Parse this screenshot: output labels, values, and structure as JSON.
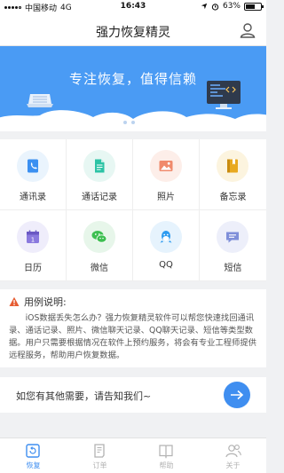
{
  "status_bar": {
    "carrier": "中国移动",
    "network": "4G",
    "time": "16:43",
    "battery_text": "63%",
    "battery_level": 0.63
  },
  "nav": {
    "title": "强力恢复精灵",
    "user_icon": "user-icon"
  },
  "banner": {
    "slogan": "专注恢复，值得信赖",
    "active_slide": 2,
    "slide_count": 3
  },
  "features": [
    {
      "label": "通讯录",
      "icon": "contacts-icon",
      "color": "#3b90f1",
      "bg": "#eaf4fd"
    },
    {
      "label": "通话记录",
      "icon": "call-log-icon",
      "color": "#2cc3a5",
      "bg": "#e7f7f3"
    },
    {
      "label": "照片",
      "icon": "photos-icon",
      "color": "#f08a6c",
      "bg": "#fdeee9"
    },
    {
      "label": "备忘录",
      "icon": "memo-icon",
      "color": "#e8a920",
      "bg": "#fcf4df"
    },
    {
      "label": "日历",
      "icon": "calendar-icon",
      "color": "#8a79de",
      "bg": "#efedfb"
    },
    {
      "label": "微信",
      "icon": "wechat-icon",
      "color": "#3dbf51",
      "bg": "#e7f6ea"
    },
    {
      "label": "QQ",
      "icon": "qq-icon",
      "color": "#2d9bf0",
      "bg": "#e6f3fd"
    },
    {
      "label": "短信",
      "icon": "sms-icon",
      "color": "#7f8fd9",
      "bg": "#edeffa"
    }
  ],
  "usage": {
    "title": "用例说明:",
    "body": "iOS数据丢失怎么办？强力恢复精灵软件可以帮您快速找回通讯录、通话记录、照片、微信聊天记录、QQ聊天记录、短信等类型数据。用户只需要根据情况在软件上预约服务，将会有专业工程师提供远程服务，帮助用户恢复数据。"
  },
  "contact": {
    "text": "如您有其他需要，请告知我们~",
    "button_icon": "arrow-right-icon"
  },
  "tabs": [
    {
      "label": "恢复",
      "icon": "recover-icon",
      "active": true
    },
    {
      "label": "订单",
      "icon": "order-icon",
      "active": false
    },
    {
      "label": "帮助",
      "icon": "help-icon",
      "active": false
    },
    {
      "label": "关于",
      "icon": "about-icon",
      "active": false
    }
  ],
  "colors": {
    "accent": "#3f8ef0",
    "banner": "#4a9bf4",
    "warning": "#e65c32"
  }
}
